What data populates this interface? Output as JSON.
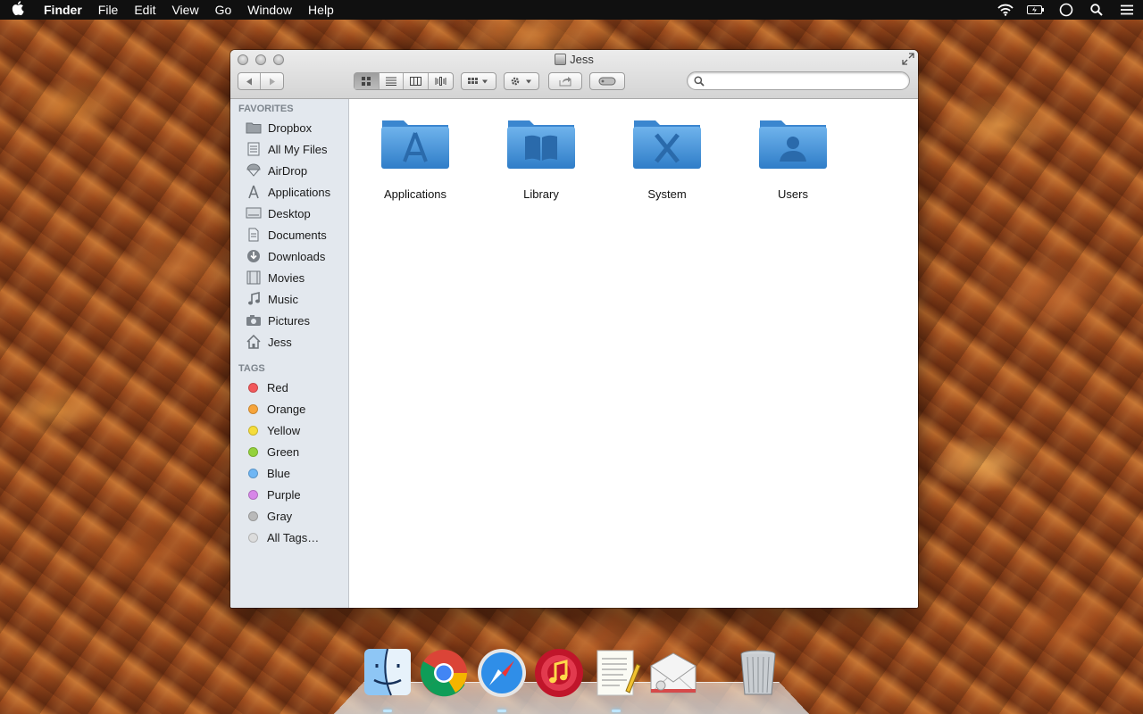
{
  "menubar": {
    "app_name": "Finder",
    "menus": [
      "File",
      "Edit",
      "View",
      "Go",
      "Window",
      "Help"
    ],
    "status_icons": [
      "wifi-icon",
      "battery-icon",
      "notification-center-icon",
      "spotlight-icon",
      "menu-list-icon"
    ]
  },
  "window": {
    "title": "Jess",
    "search": {
      "value": "",
      "placeholder": ""
    }
  },
  "sidebar": {
    "favorites_header": "FAVORITES",
    "favorites": [
      {
        "label": "Dropbox",
        "icon": "dropbox-folder-icon"
      },
      {
        "label": "All My Files",
        "icon": "all-files-icon"
      },
      {
        "label": "AirDrop",
        "icon": "airdrop-icon"
      },
      {
        "label": "Applications",
        "icon": "applications-icon"
      },
      {
        "label": "Desktop",
        "icon": "desktop-icon"
      },
      {
        "label": "Documents",
        "icon": "documents-icon"
      },
      {
        "label": "Downloads",
        "icon": "downloads-icon"
      },
      {
        "label": "Movies",
        "icon": "movies-icon"
      },
      {
        "label": "Music",
        "icon": "music-icon"
      },
      {
        "label": "Pictures",
        "icon": "pictures-icon"
      },
      {
        "label": "Jess",
        "icon": "home-icon"
      }
    ],
    "tags_header": "TAGS",
    "tags": [
      {
        "label": "Red",
        "color": "#f2585b"
      },
      {
        "label": "Orange",
        "color": "#f6a43a"
      },
      {
        "label": "Yellow",
        "color": "#f5dd3b"
      },
      {
        "label": "Green",
        "color": "#94d23b"
      },
      {
        "label": "Blue",
        "color": "#6fb6f4"
      },
      {
        "label": "Purple",
        "color": "#d787e8"
      },
      {
        "label": "Gray",
        "color": "#b9b9b9"
      },
      {
        "label": "All Tags…",
        "color": "#dcdcdc"
      }
    ]
  },
  "content": {
    "items": [
      {
        "label": "Applications",
        "icon": "applications-folder-icon"
      },
      {
        "label": "Library",
        "icon": "library-folder-icon"
      },
      {
        "label": "System",
        "icon": "system-folder-icon"
      },
      {
        "label": "Users",
        "icon": "users-folder-icon"
      }
    ]
  },
  "dock": {
    "apps": [
      "finder-icon",
      "chrome-icon",
      "safari-icon",
      "itunes-icon",
      "textedit-icon",
      "mail-icon",
      "trash-icon"
    ]
  }
}
